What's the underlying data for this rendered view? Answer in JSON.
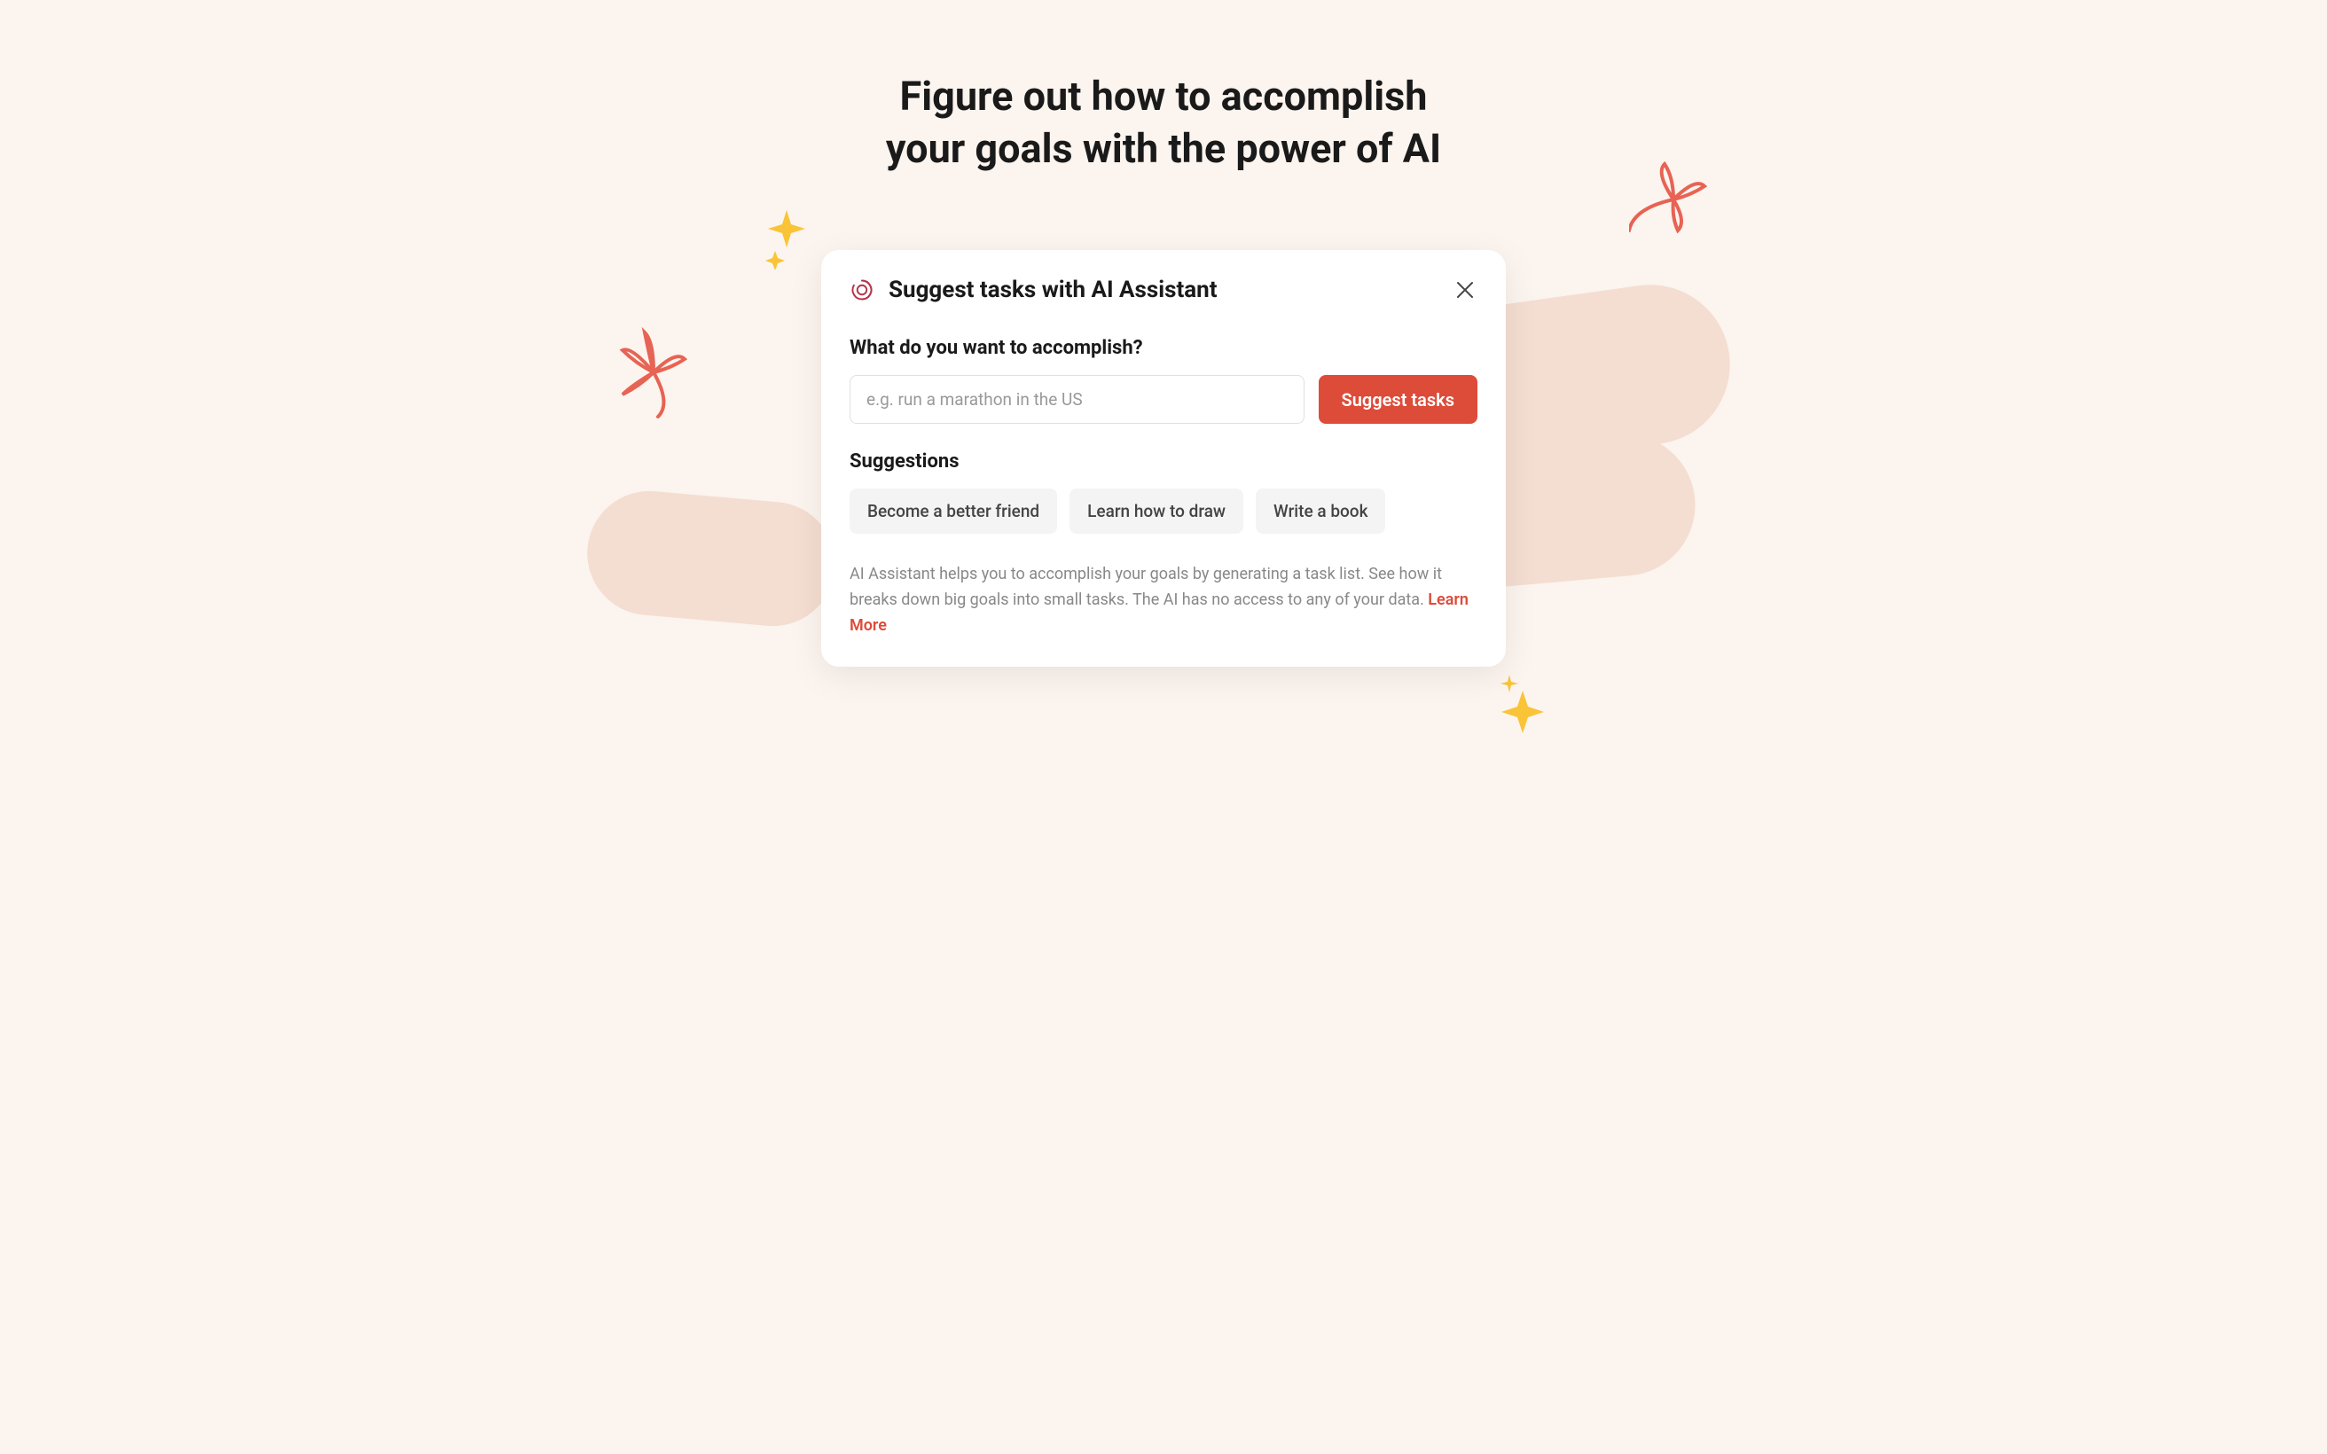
{
  "headline": {
    "line1": "Figure out how to accomplish",
    "line2": "your goals with the power of AI"
  },
  "modal": {
    "title": "Suggest tasks with AI Assistant",
    "prompt_label": "What do you want to accomplish?",
    "input_placeholder": "e.g. run a marathon in the US",
    "suggest_button": "Suggest tasks",
    "suggestions_label": "Suggestions",
    "chips": [
      "Become a better friend",
      "Learn how to draw",
      "Write a book"
    ],
    "helper_text": "AI Assistant helps you to accomplish your goals by generating a task list. See how it breaks down big goals into small tasks. The AI has no access to any of your data. ",
    "learn_more": "Learn More"
  },
  "colors": {
    "background": "#fcf4ee",
    "accent": "#dd4b39",
    "brush": "#f4ded1",
    "sparkle": "#f9c438",
    "flower": "#e76354"
  }
}
